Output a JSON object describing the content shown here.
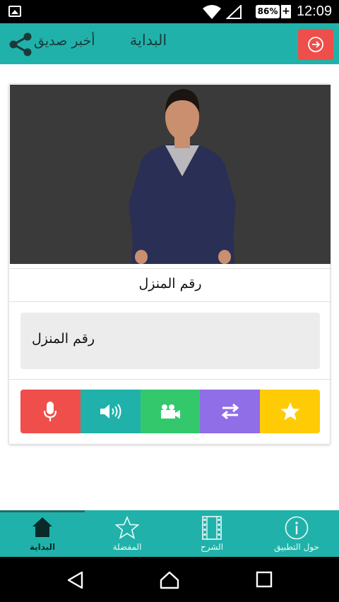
{
  "status_bar": {
    "battery": "86%",
    "charge_symbol": "+",
    "time": "12:09"
  },
  "app_bar": {
    "title": "البداية",
    "share_label": "أخبر صديق",
    "icons": [
      "logout-icon",
      "share-icon"
    ]
  },
  "card": {
    "word": "رقم المنزل",
    "text_box": "رقم المنزل",
    "actions": [
      "microphone-icon",
      "speaker-icon",
      "video-camera-icon",
      "swap-arrows-icon",
      "star-icon"
    ]
  },
  "bottom_nav": {
    "items": [
      {
        "label": "البداية",
        "icon": "home-icon",
        "active": true
      },
      {
        "label": "المفضلة",
        "icon": "star-outline-icon",
        "active": false
      },
      {
        "label": "الشرح",
        "icon": "film-icon",
        "active": false
      },
      {
        "label": "حول التطبيق",
        "icon": "info-icon",
        "active": false
      }
    ]
  },
  "colors": {
    "primary": "#20b2aa",
    "red": "#ef4e4a",
    "green": "#34c86c",
    "purple": "#8f6ee8",
    "yellow": "#fecb05"
  }
}
